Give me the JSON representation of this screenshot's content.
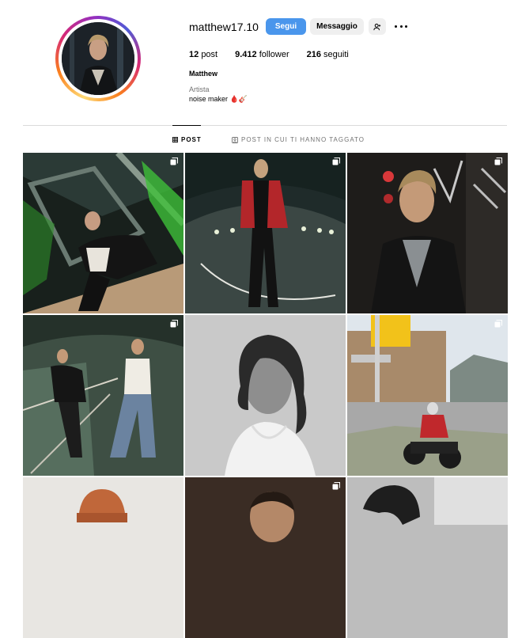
{
  "profile": {
    "username": "matthew17.10",
    "follow_label": "Segui",
    "message_label": "Messaggio",
    "posts_count": "12",
    "posts_label": "post",
    "followers_count": "9.412",
    "followers_label": "follower",
    "following_count": "216",
    "following_label": "seguiti",
    "full_name": "Matthew",
    "category": "Artista",
    "bio": "noise maker 🩸🎸"
  },
  "tabs": {
    "posts": "POST",
    "tagged": "POST IN CUI TI HANNO TAGGATO"
  },
  "icons": {
    "suggest": "person-add-icon",
    "more": "more-horizontal-icon",
    "grid": "grid-icon",
    "tagged": "tagged-icon",
    "multi": "carousel-icon"
  },
  "colors": {
    "follow_button": "#4a96ec",
    "secondary_button": "#efefef",
    "muted_text": "#737373"
  }
}
